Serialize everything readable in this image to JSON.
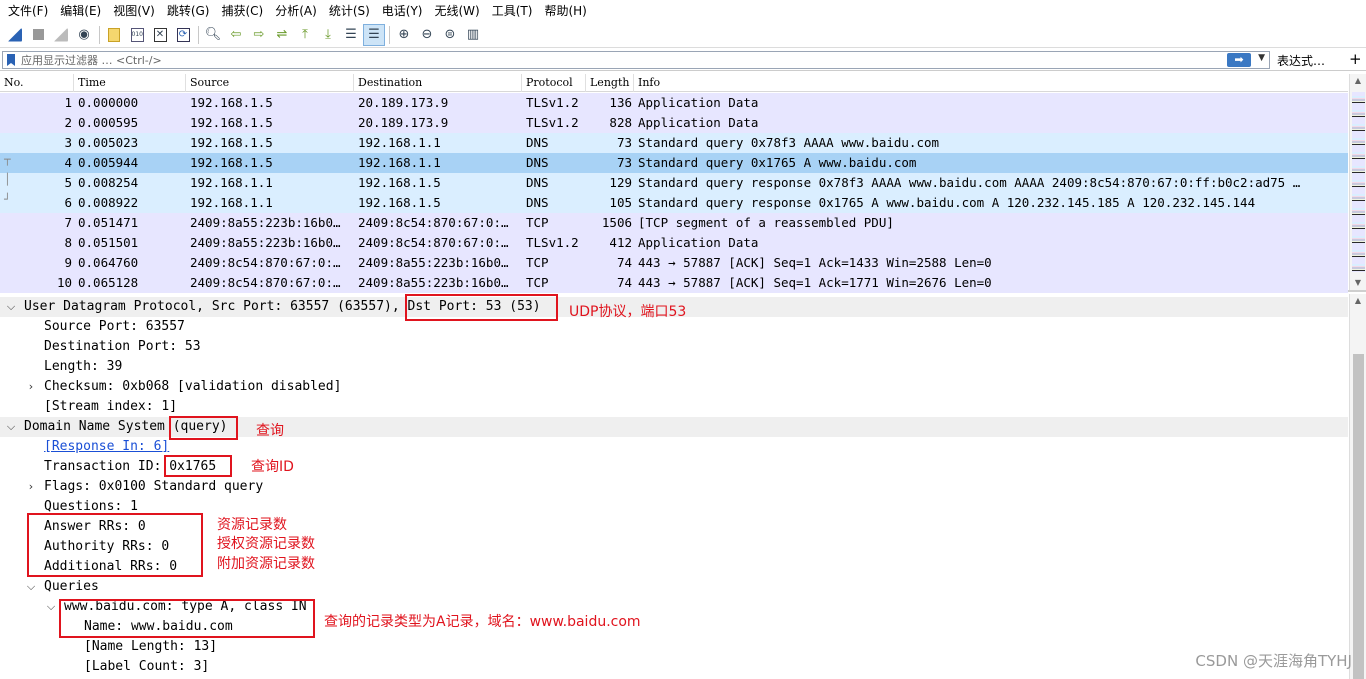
{
  "menu": [
    "文件(F)",
    "编辑(E)",
    "视图(V)",
    "跳转(G)",
    "捕获(C)",
    "分析(A)",
    "统计(S)",
    "电话(Y)",
    "无线(W)",
    "工具(T)",
    "帮助(H)"
  ],
  "filter": {
    "placeholder": "应用显示过滤器 … <Ctrl-/>",
    "apply_glyph": "➡",
    "dropdown_glyph": "▼",
    "expression_label": "表达式…",
    "add_label": "+"
  },
  "packet_list": {
    "columns": [
      "No.",
      "Time",
      "Source",
      "Destination",
      "Protocol",
      "Length",
      "Info"
    ],
    "rows": [
      {
        "no": "1",
        "time": "0.000000",
        "src": "192.168.1.5",
        "dst": "20.189.173.9",
        "proto": "TLSv1.2",
        "len": "136",
        "info": "Application Data",
        "color": "#e7e6ff"
      },
      {
        "no": "2",
        "time": "0.000595",
        "src": "192.168.1.5",
        "dst": "20.189.173.9",
        "proto": "TLSv1.2",
        "len": "828",
        "info": "Application Data",
        "color": "#e7e6ff"
      },
      {
        "no": "3",
        "time": "0.005023",
        "src": "192.168.1.5",
        "dst": "192.168.1.1",
        "proto": "DNS",
        "len": "73",
        "info": "Standard query 0x78f3 AAAA www.baidu.com",
        "color": "#daeeff"
      },
      {
        "no": "4",
        "time": "0.005944",
        "src": "192.168.1.5",
        "dst": "192.168.1.1",
        "proto": "DNS",
        "len": "73",
        "info": "Standard query 0x1765 A www.baidu.com",
        "color": "#a8d2f5"
      },
      {
        "no": "5",
        "time": "0.008254",
        "src": "192.168.1.1",
        "dst": "192.168.1.5",
        "proto": "DNS",
        "len": "129",
        "info": "Standard query response 0x78f3 AAAA www.baidu.com AAAA 2409:8c54:870:67:0:ff:b0c2:ad75 …",
        "color": "#daeeff"
      },
      {
        "no": "6",
        "time": "0.008922",
        "src": "192.168.1.1",
        "dst": "192.168.1.5",
        "proto": "DNS",
        "len": "105",
        "info": "Standard query response 0x1765 A www.baidu.com A 120.232.145.185 A 120.232.145.144",
        "color": "#daeeff"
      },
      {
        "no": "7",
        "time": "0.051471",
        "src": "2409:8a55:223b:16b0…",
        "dst": "2409:8c54:870:67:0:…",
        "proto": "TCP",
        "len": "1506",
        "info": "[TCP segment of a reassembled PDU]",
        "color": "#e7e6ff"
      },
      {
        "no": "8",
        "time": "0.051501",
        "src": "2409:8a55:223b:16b0…",
        "dst": "2409:8c54:870:67:0:…",
        "proto": "TLSv1.2",
        "len": "412",
        "info": "Application Data",
        "color": "#e7e6ff"
      },
      {
        "no": "9",
        "time": "0.064760",
        "src": "2409:8c54:870:67:0:…",
        "dst": "2409:8a55:223b:16b0…",
        "proto": "TCP",
        "len": "74",
        "info": "443 → 57887 [ACK] Seq=1 Ack=1433 Win=2588 Len=0",
        "color": "#e7e6ff"
      },
      {
        "no": "10",
        "time": "0.065128",
        "src": "2409:8c54:870:67:0:…",
        "dst": "2409:8a55:223b:16b0…",
        "proto": "TCP",
        "len": "74",
        "info": "443 → 57887 [ACK] Seq=1 Ack=1771 Win=2676 Len=0",
        "color": "#e7e6ff"
      }
    ]
  },
  "details": {
    "udp_header": "User Datagram Protocol, Src Port: 63557 (63557), Dst Port: 53 (53)",
    "src_port": "Source Port: 63557",
    "dst_port": "Destination Port: 53",
    "length": "Length: 39",
    "checksum": "Checksum: 0xb068 [validation disabled]",
    "stream_index": "[Stream index: 1]",
    "dns_header": "Domain Name System (query)",
    "response_in": "[Response In: 6]",
    "transaction_id": "Transaction ID: 0x1765",
    "flags": "Flags: 0x0100 Standard query",
    "questions": "Questions: 1",
    "answer_rrs": "Answer RRs: 0",
    "authority_rrs": "Authority RRs: 0",
    "additional_rrs": "Additional RRs: 0",
    "queries": "Queries",
    "query_entry": "www.baidu.com: type A, class IN",
    "name": "Name: www.baidu.com",
    "name_length": "[Name Length: 13]",
    "label_count": "[Label Count: 3]"
  },
  "annotations": {
    "udp": "UDP协议，端口53",
    "query": "查询",
    "query_id": "查询ID",
    "answer": "资源记录数",
    "authority": "授权资源记录数",
    "additional": "附加资源记录数",
    "record": "查询的记录类型为A记录，域名：www.baidu.com"
  },
  "watermark": "CSDN @天涯海角TYHJ"
}
